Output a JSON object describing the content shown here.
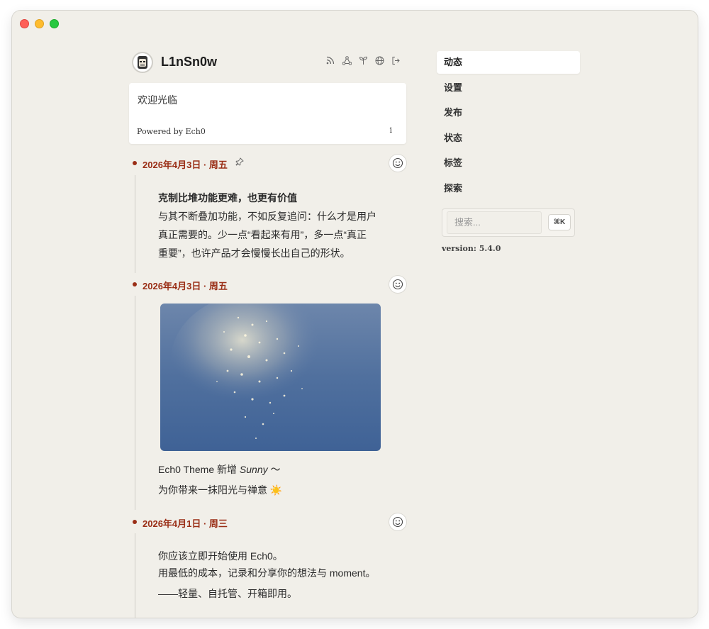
{
  "profile": {
    "name": "L1nSn0w"
  },
  "header_icons": [
    "rss-icon",
    "share-icon",
    "sprout-icon",
    "globe-icon",
    "logout-icon"
  ],
  "welcome": {
    "text": "欢迎光临",
    "powered": "Powered by Ech0",
    "info": "i"
  },
  "posts": [
    {
      "date": "2026年4月3日 · 周五",
      "pinned": true,
      "title": "克制比堆功能更难，也更有价值",
      "lines": [
        "与其不断叠加功能，不如反复追问：什么才是用户",
        "真正需要的。少一点“看起来有用”，多一点“真正",
        "重要”，也许产品才会慢慢长出自己的形状。"
      ]
    },
    {
      "date": "2026年4月3日 · 周五",
      "pinned": false,
      "line1_prefix": "Ech0 Theme 新增 ",
      "line1_em": "Sunny",
      "line1_suffix": " ～",
      "line2": "为你带来一抹阳光与禅意 ☀️"
    },
    {
      "date": "2026年4月1日 · 周三",
      "pinned": false,
      "lines": [
        "你应该立即开始使用 Ech0。",
        "用最低的成本，记录和分享你的想法与 moment。",
        "——轻量、自托管、开箱即用。"
      ]
    }
  ],
  "nav": {
    "items": [
      "动态",
      "设置",
      "发布",
      "状态",
      "标签",
      "探索"
    ],
    "active": "动态"
  },
  "search": {
    "placeholder": "搜索...",
    "shortcut": "⌘K"
  },
  "version": "version: 5.4.0",
  "colors": {
    "accent": "#9a2e16",
    "background": "#f1efe9",
    "card": "#ffffff"
  }
}
